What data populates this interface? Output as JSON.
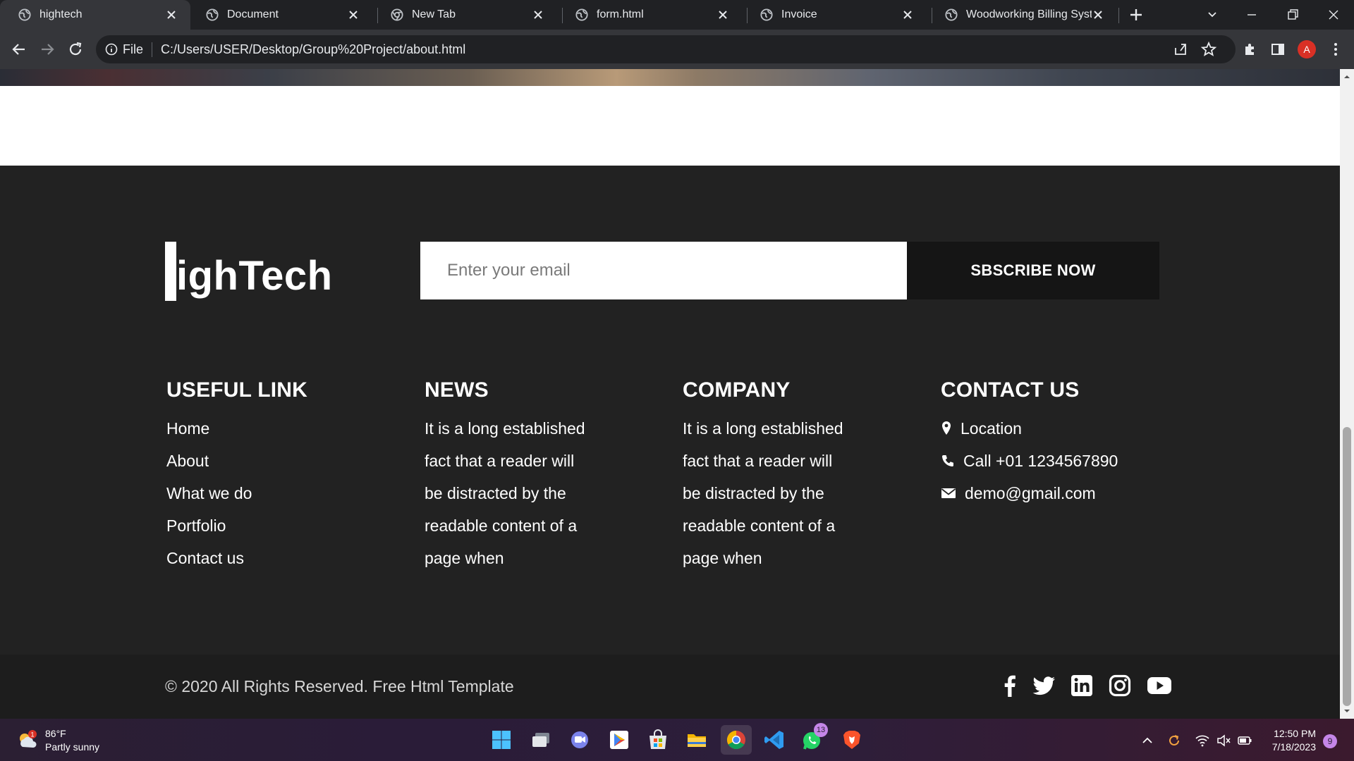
{
  "browser": {
    "tabs": [
      {
        "title": "hightech",
        "active": true
      },
      {
        "title": "Document",
        "active": false
      },
      {
        "title": "New Tab",
        "active": false
      },
      {
        "title": "form.html",
        "active": false
      },
      {
        "title": "Invoice",
        "active": false
      },
      {
        "title": "Woodworking Billing Syster",
        "active": false
      }
    ],
    "address_prefix": "File",
    "address_url": "C:/Users/USER/Desktop/Group%20Project/about.html",
    "profile_initial": "A"
  },
  "footer": {
    "logo_text": "ighTech",
    "email_placeholder": "Enter your email",
    "subscribe_label": "SBSCRIBE NOW",
    "useful_link": {
      "heading": "USEFUL LINK",
      "items": [
        "Home",
        "About",
        "What we do",
        "Portfolio",
        "Contact us"
      ]
    },
    "news": {
      "heading": "NEWS",
      "lines": [
        "It is a long established",
        "fact that a reader will",
        "be distracted by the",
        "readable content of a",
        "page when"
      ]
    },
    "company": {
      "heading": "COMPANY",
      "lines": [
        "It is a long established",
        "fact that a reader will",
        "be distracted by the",
        "readable content of a",
        "page when"
      ]
    },
    "contact": {
      "heading": "CONTACT US",
      "location": "Location",
      "phone": "Call +01 1234567890",
      "email": "demo@gmail.com"
    },
    "copyright": "© 2020 All Rights Reserved. Free Html Template",
    "social_icons": [
      "facebook-icon",
      "twitter-icon",
      "linkedin-icon",
      "instagram-icon",
      "youtube-icon"
    ]
  },
  "taskbar": {
    "weather_temp": "86°F",
    "weather_desc": "Partly sunny",
    "weather_badge": "1",
    "whatsapp_badge": "13",
    "time": "12:50 PM",
    "date": "7/18/2023",
    "notification_count": "9"
  }
}
